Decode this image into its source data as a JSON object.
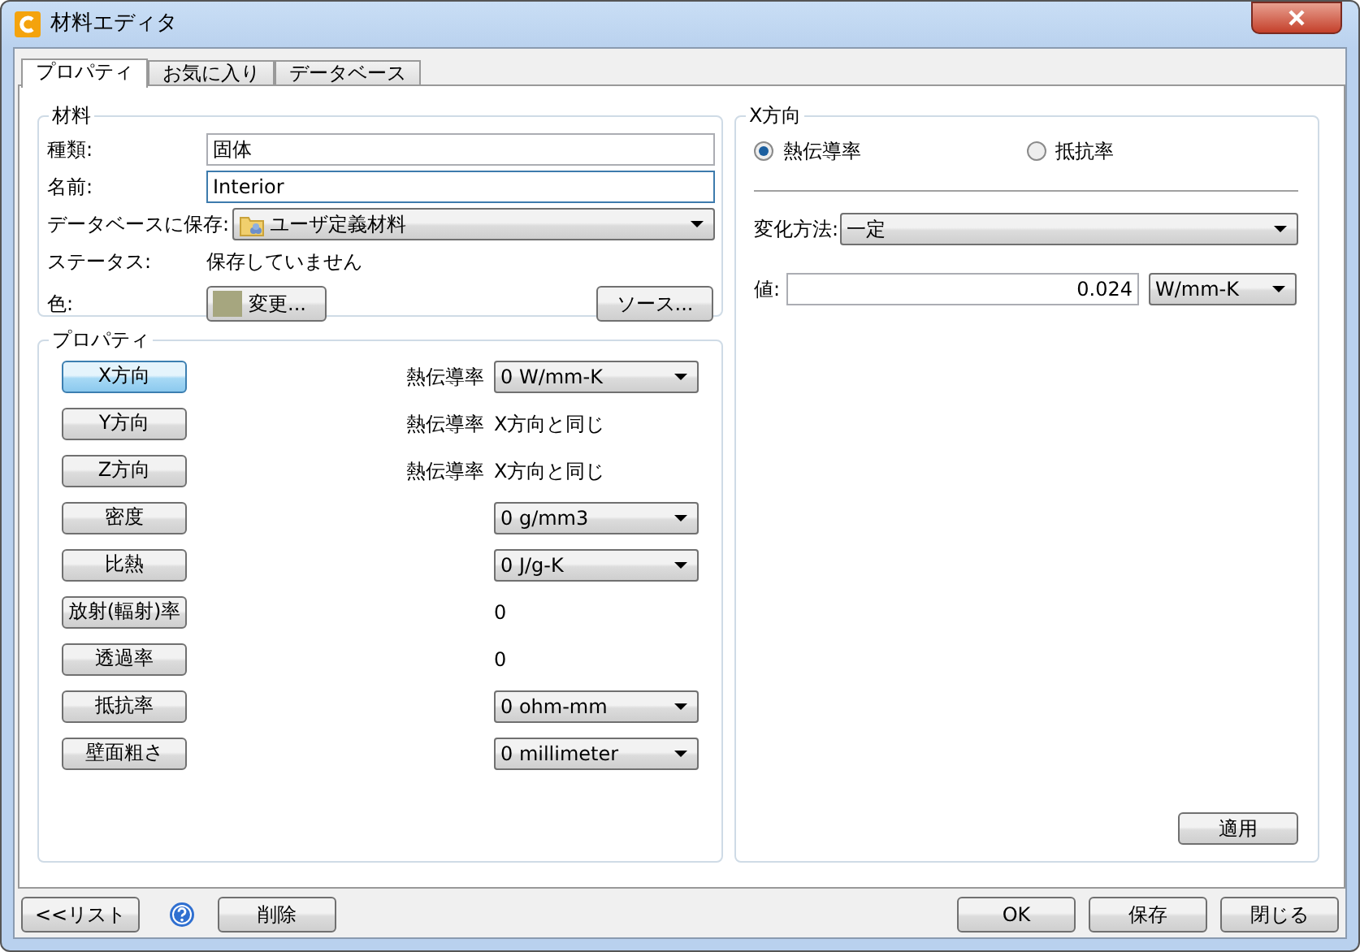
{
  "window": {
    "title": "材料エディタ"
  },
  "tabs": [
    {
      "label": "プロパティ",
      "selected": true
    },
    {
      "label": "お気に入り",
      "selected": false
    },
    {
      "label": "データベース",
      "selected": false
    }
  ],
  "material": {
    "title": "材料",
    "fields": [
      {
        "kind": "text",
        "label": "種類:",
        "value": "固体",
        "focused": false
      },
      {
        "kind": "text",
        "label": "名前:",
        "value": "Interior",
        "focused": true
      },
      {
        "kind": "dropdown",
        "label": "データベースに保存:",
        "value": "ユーザ定義材料"
      },
      {
        "kind": "static",
        "label": "ステータス:",
        "value": "保存していません"
      },
      {
        "kind": "color",
        "label": "色:",
        "color": "#a6a67f",
        "button": "変更...",
        "extra_button": "ソース..."
      }
    ]
  },
  "properties": {
    "title": "プロパティ",
    "rows": [
      {
        "button": "X方向",
        "selected": true,
        "kind": "dropdown",
        "label": "熱伝導率",
        "value": "0 W/mm-K"
      },
      {
        "button": "Y方向",
        "selected": false,
        "kind": "static",
        "label": "熱伝導率",
        "value": "X方向と同じ"
      },
      {
        "button": "Z方向",
        "selected": false,
        "kind": "static",
        "label": "熱伝導率",
        "value": "X方向と同じ"
      },
      {
        "button": "密度",
        "selected": false,
        "kind": "dropdown",
        "value": "0 g/mm3"
      },
      {
        "button": "比熱",
        "selected": false,
        "kind": "dropdown",
        "value": "0 J/g-K"
      },
      {
        "button": "放射(輻射)率",
        "selected": false,
        "kind": "static",
        "value": "0"
      },
      {
        "button": "透過率",
        "selected": false,
        "kind": "static",
        "value": "0"
      },
      {
        "button": "抵抗率",
        "selected": false,
        "kind": "dropdown",
        "value": "0 ohm-mm"
      },
      {
        "button": "壁面粗さ",
        "selected": false,
        "kind": "dropdown",
        "value": "0 millimeter"
      }
    ]
  },
  "direction": {
    "title": "X方向",
    "radios": [
      {
        "label": "熱伝導率",
        "selected": true
      },
      {
        "label": "抵抗率",
        "selected": false
      }
    ],
    "method": {
      "label": "変化方法:",
      "value": "一定"
    },
    "value_field": {
      "label": "値:",
      "value": "0.024",
      "unit": "W/mm-K"
    },
    "apply_button": "適用"
  },
  "footer": {
    "list_button": "<<リスト",
    "delete_button": "削除",
    "buttons": [
      "OK",
      "保存",
      "閉じる"
    ]
  }
}
